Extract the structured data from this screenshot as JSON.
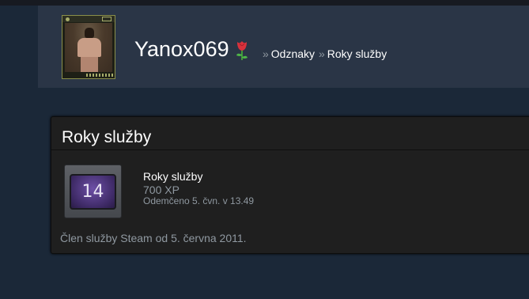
{
  "profile": {
    "username": "Yanox069",
    "avatar": "avatar-image",
    "flair_icon": "rose-icon"
  },
  "breadcrumb": {
    "separator": "»",
    "items": [
      {
        "label": "Odznaky"
      },
      {
        "label": "Roky služby"
      }
    ]
  },
  "panel": {
    "title": "Roky služby",
    "badge": {
      "icon_label": "14",
      "name": "Roky služby",
      "xp": "700 XP",
      "unlocked": "Odemčeno 5. čvn. v 13.49"
    },
    "member_since": "Člen služby Steam od 5. června 2011."
  },
  "colors": {
    "page_bg": "#1b2838",
    "header_bg": "#2a3546",
    "panel_bg": "#1f1f1f",
    "muted_text": "#8f98a0",
    "badge_purple": "#3e2a66"
  }
}
